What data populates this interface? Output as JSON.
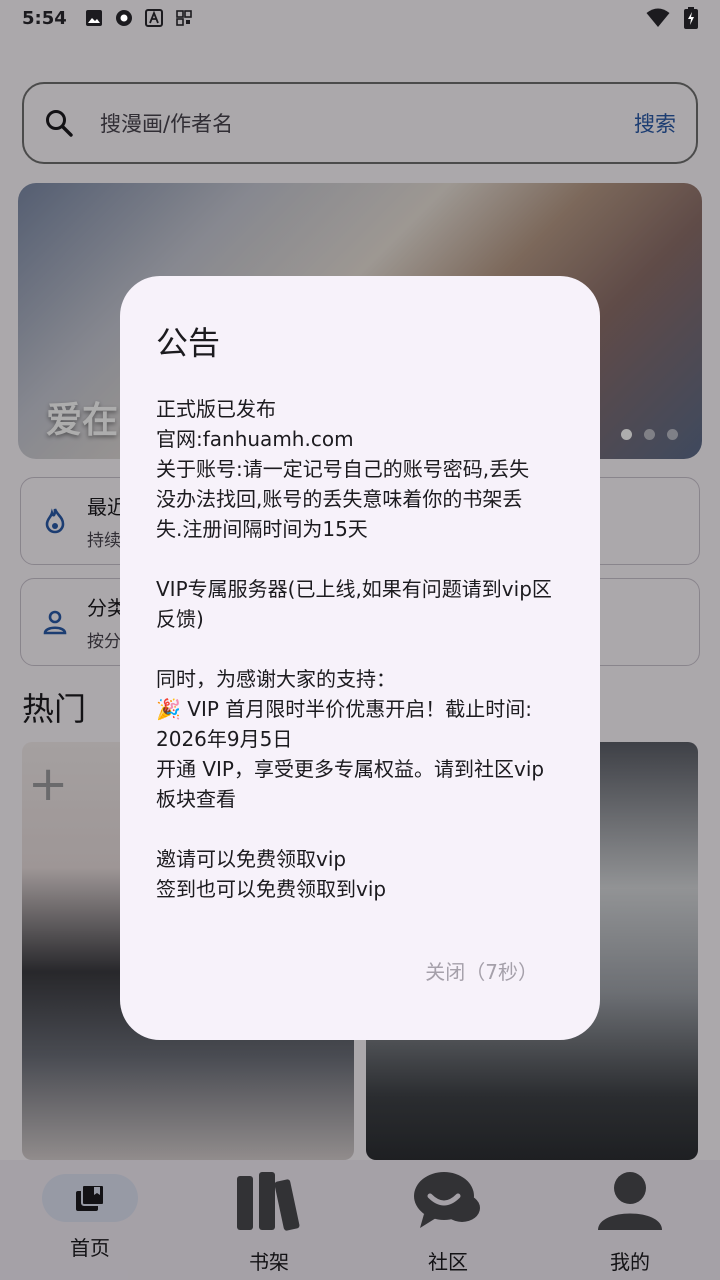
{
  "status_bar": {
    "time": "5:54"
  },
  "search": {
    "placeholder": "搜漫画/作者名",
    "button_label": "搜索"
  },
  "banner": {
    "title": "爱在."
  },
  "cards": [
    {
      "title": "最近",
      "subtitle": "持续"
    },
    {
      "title": "分类",
      "subtitle": "按分"
    }
  ],
  "section": {
    "hot_title": "热门"
  },
  "dialog": {
    "title": "公告",
    "lines": [
      "正式版已发布",
      "官网:fanhuamh.com",
      "关于账号:请一定记号自己的账号密码,丢失",
      "没办法找回,账号的丢失意味着你的书架丢",
      "失.注册间隔时间为15天",
      "",
      "VIP专属服务器(已上线,如果有问题请到vip区",
      "反馈)",
      "",
      "同时，为感谢大家的支持：",
      "🎉 VIP 首月限时半价优惠开启！截止时间:",
      "2026年9月5日",
      "开通 VIP，享受更多专属权益。请到社区vip",
      "板块查看",
      "",
      "邀请可以免费领取vip",
      "签到也可以免费领取到vip"
    ],
    "close_label": "关闭（7秒）"
  },
  "bottom_nav": {
    "items": [
      {
        "label": "首页",
        "icon": "home-book-icon",
        "selected": true
      },
      {
        "label": "书架",
        "icon": "bookshelf-icon",
        "selected": false
      },
      {
        "label": "社区",
        "icon": "community-chat-icon",
        "selected": false
      },
      {
        "label": "我的",
        "icon": "profile-icon",
        "selected": false
      }
    ]
  },
  "colors": {
    "accent": "#2a5aa8",
    "dialog_bg": "#f7f2fa",
    "nav_bg": "#f3edf7",
    "pill": "#dfe3f4"
  }
}
